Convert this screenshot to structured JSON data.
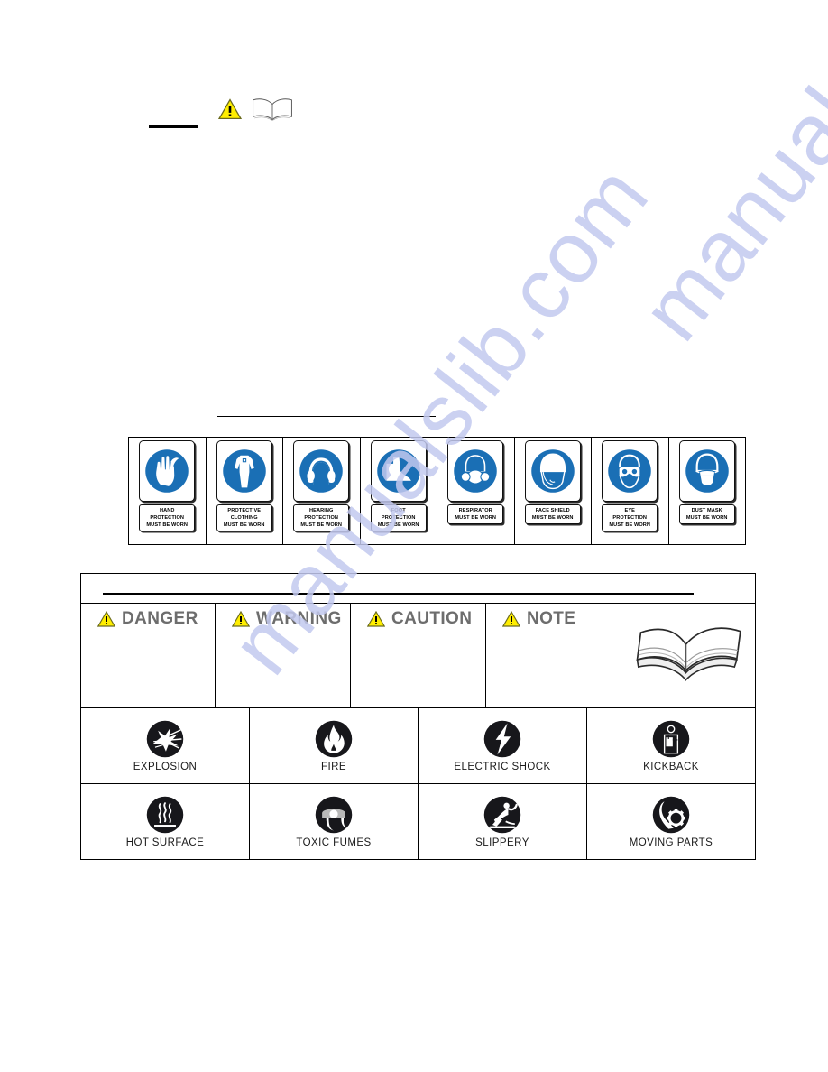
{
  "page": {
    "watermark_text": "manualslib.com",
    "watermark_color": "#c3c9ef",
    "background": "#ffffff"
  },
  "header_block": {
    "warning_triangle_icon": "warning-triangle-icon",
    "manual_book_icon": "open-book-icon"
  },
  "ppe_table": {
    "items": [
      {
        "icon": "hand-protection-icon",
        "lines": [
          "HAND",
          "PROTECTION",
          "MUST BE WORN"
        ]
      },
      {
        "icon": "protective-clothing-icon",
        "lines": [
          "PROTECTIVE",
          "CLOTHING",
          "MUST BE WORN"
        ]
      },
      {
        "icon": "hearing-protection-icon",
        "lines": [
          "HEARING",
          "PROTECTION",
          "MUST BE WORN"
        ]
      },
      {
        "icon": "foot-protection-icon",
        "lines": [
          "FOOT",
          "PROTECTION",
          "MUST BE WORN"
        ]
      },
      {
        "icon": "respirator-icon",
        "lines": [
          "RESPIRATOR",
          "MUST BE WORN"
        ]
      },
      {
        "icon": "face-shield-icon",
        "lines": [
          "FACE SHIELD",
          "MUST BE WORN"
        ]
      },
      {
        "icon": "eye-protection-icon",
        "lines": [
          "EYE",
          "PROTECTION",
          "MUST BE WORN"
        ]
      },
      {
        "icon": "dust-mask-icon",
        "lines": [
          "DUST MASK",
          "MUST BE WORN"
        ]
      }
    ],
    "sign_blue": "#1a6fb5"
  },
  "signal_words": {
    "items": [
      {
        "label": "DANGER",
        "icon": "warning-triangle-icon"
      },
      {
        "label": "WARNING",
        "icon": "warning-triangle-icon"
      },
      {
        "label": "CAUTION",
        "icon": "warning-triangle-icon"
      },
      {
        "label": "NOTE",
        "icon": "warning-triangle-icon"
      }
    ],
    "book_cell_icon": "open-book-icon",
    "text_color": "#6d6d6d",
    "triangle_fill": "#ffee00"
  },
  "hazards": {
    "row1": [
      {
        "label": "EXPLOSION",
        "icon": "explosion-icon"
      },
      {
        "label": "FIRE",
        "icon": "fire-icon"
      },
      {
        "label": "ELECTRIC SHOCK",
        "icon": "electric-shock-icon"
      },
      {
        "label": "KICKBACK",
        "icon": "kickback-icon"
      }
    ],
    "row2": [
      {
        "label": "HOT SURFACE",
        "icon": "hot-surface-icon"
      },
      {
        "label": "TOXIC FUMES",
        "icon": "toxic-fumes-icon"
      },
      {
        "label": "SLIPPERY",
        "icon": "slippery-icon"
      },
      {
        "label": "MOVING PARTS",
        "icon": "moving-parts-icon"
      }
    ]
  }
}
